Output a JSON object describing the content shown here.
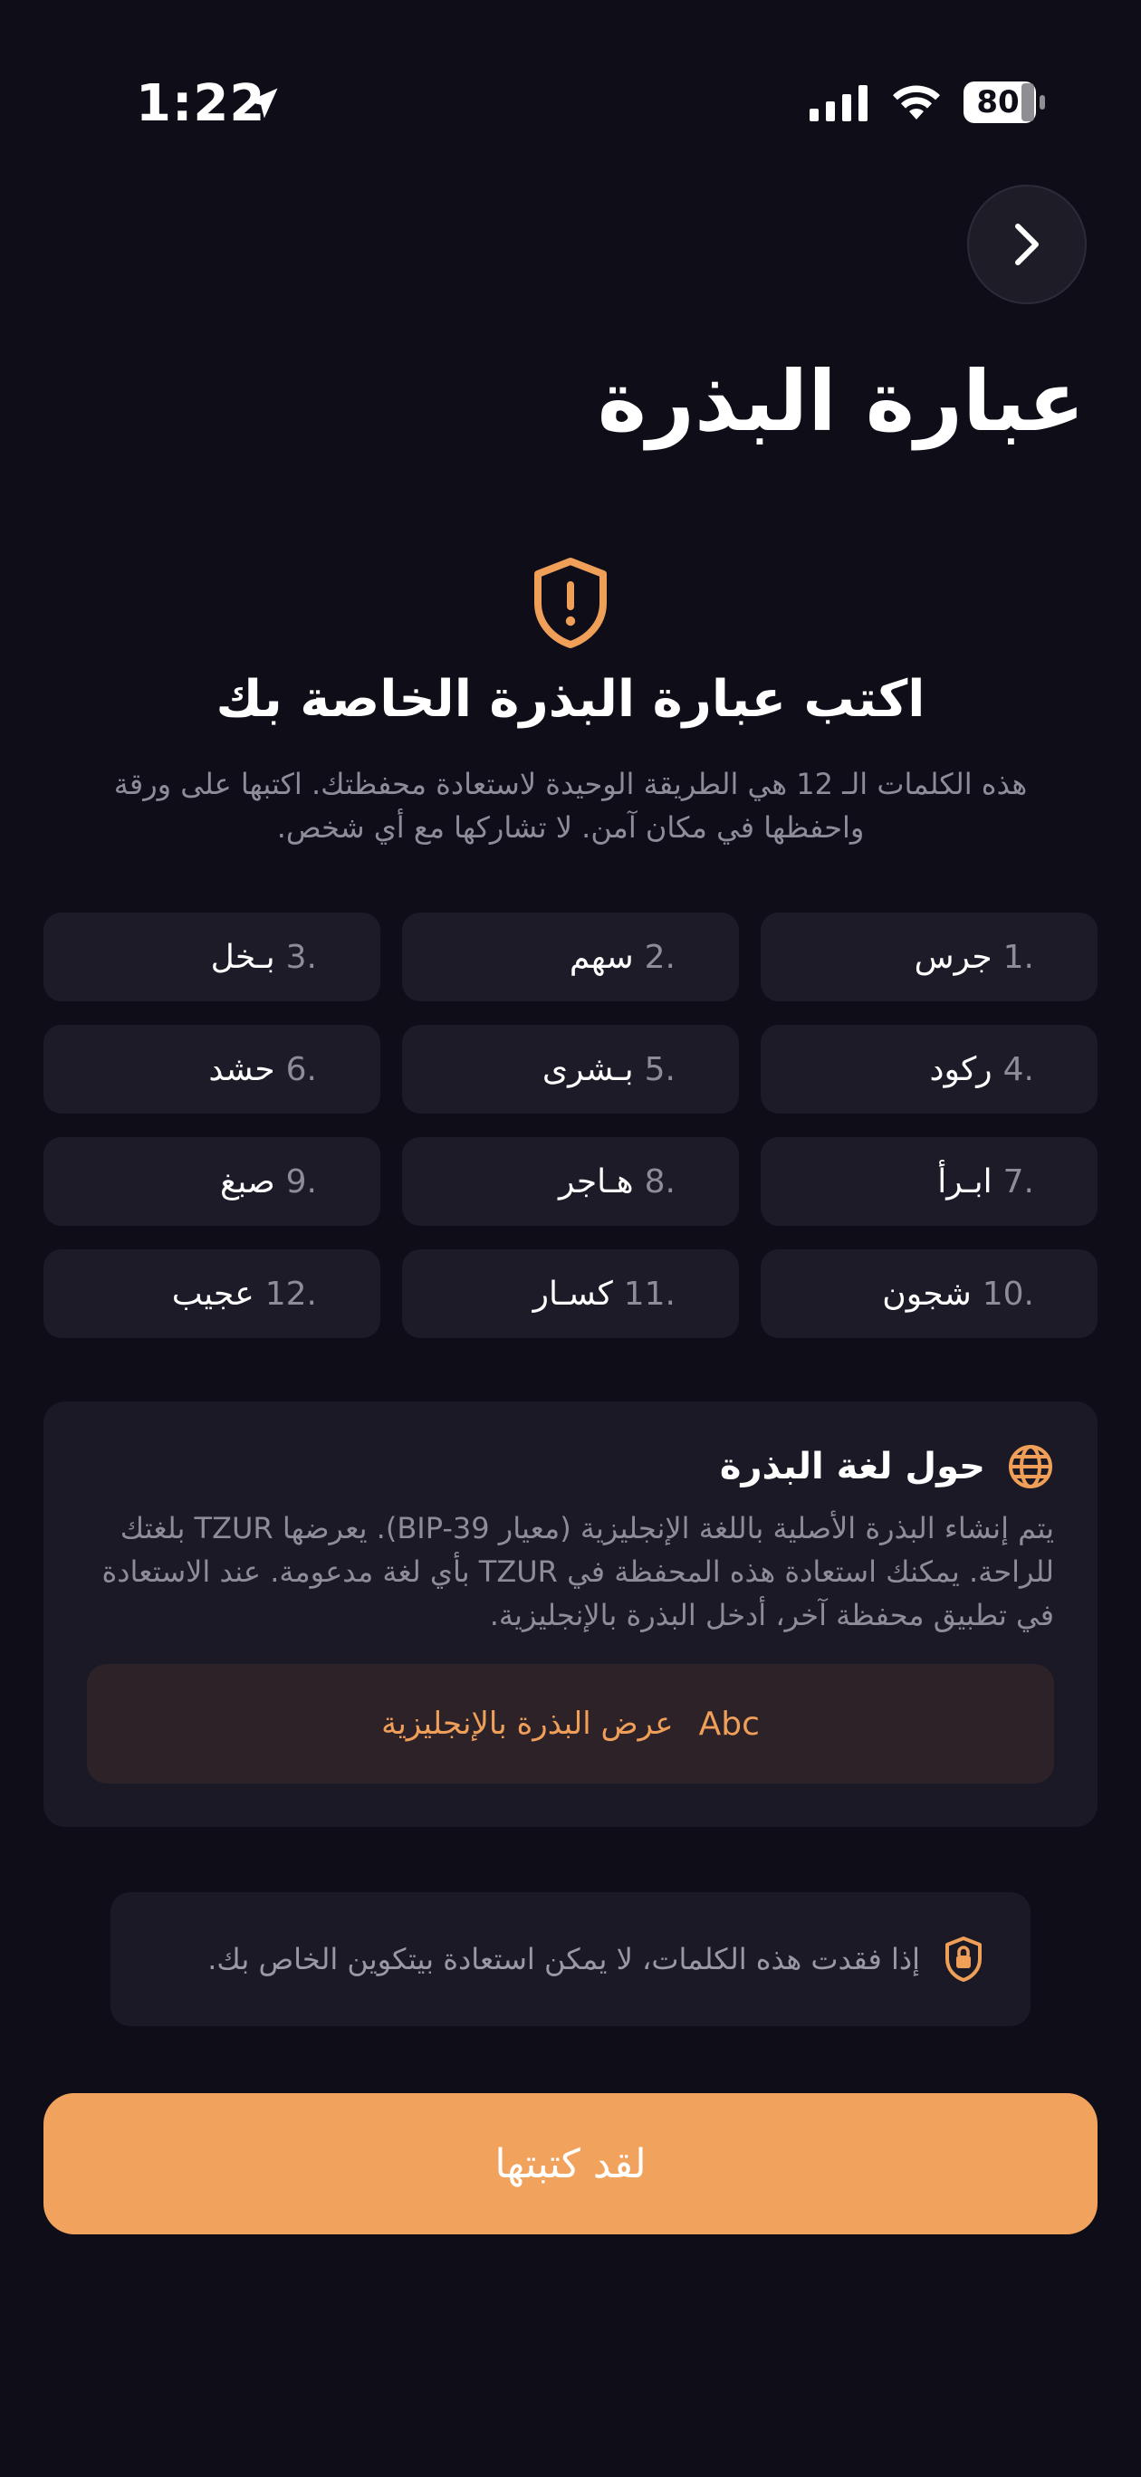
{
  "status_bar": {
    "time": "1:22",
    "battery": "80"
  },
  "header": {
    "title": "عبارة البذرة"
  },
  "intro": {
    "subtitle": "اكتب عبارة البذرة الخاصة بك",
    "description": "هذه الكلمات الـ 12 هي الطريقة الوحيدة لاستعادة محفظتك. اكتبها على ورقة واحفظها في مكان آمن. لا تشاركها مع أي شخص."
  },
  "seed_words": [
    {
      "num": "1.",
      "word": "جرس"
    },
    {
      "num": "2.",
      "word": "سهم"
    },
    {
      "num": "3.",
      "word": "بـخل"
    },
    {
      "num": "4.",
      "word": "ركود"
    },
    {
      "num": "5.",
      "word": "بـشرى"
    },
    {
      "num": "6.",
      "word": "حشد"
    },
    {
      "num": "7.",
      "word": "ابـرأ"
    },
    {
      "num": "8.",
      "word": "هـاجر"
    },
    {
      "num": "9.",
      "word": "صبغ"
    },
    {
      "num": "10.",
      "word": "شجون"
    },
    {
      "num": "11.",
      "word": "كسـار"
    },
    {
      "num": "12.",
      "word": "عجيب"
    }
  ],
  "language_card": {
    "title": "حول لغة البذرة",
    "body": "يتم إنشاء البذرة الأصلية باللغة الإنجليزية (معيار BIP-39). يعرضها TZUR بلغتك للراحة. يمكنك استعادة هذه المحفظة في TZUR بأي لغة مدعومة. عند الاستعادة في تطبيق محفظة آخر، أدخل البذرة بالإنجليزية.",
    "show_english_label": "عرض البذرة بالإنجليزية",
    "abc_label": "Abc"
  },
  "warning": {
    "text": "إذا فقدت هذه الكلمات، لا يمكن استعادة بيتكوين الخاص بك."
  },
  "cta": {
    "label": "لقد كتبتها"
  },
  "colors": {
    "background": "#0f0e18",
    "card": "#1c1b27",
    "accent": "#f1a25c",
    "muted_text": "#8e8c99"
  },
  "icons": [
    "location-arrow-icon",
    "signal-icon",
    "wifi-icon",
    "battery-icon",
    "chevron-right-icon",
    "shield-alert-icon",
    "globe-icon",
    "lock-shield-icon"
  ]
}
